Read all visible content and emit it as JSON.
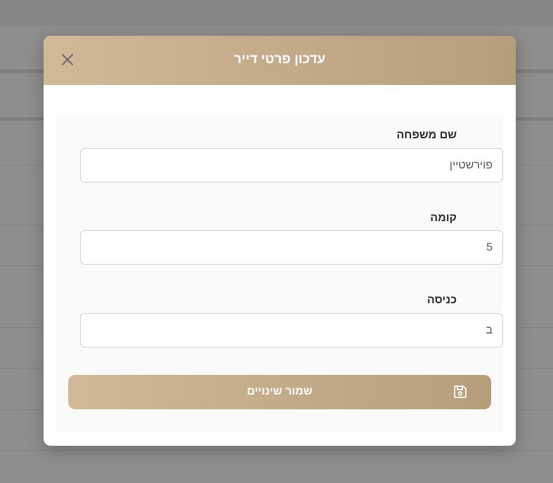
{
  "modal": {
    "title": "עדכון פרטי דייר",
    "close_icon": "close-icon"
  },
  "form": {
    "fields": [
      {
        "label": "שם משפחה",
        "value": "פוירשטיין"
      },
      {
        "label": "קומה",
        "value": "5"
      },
      {
        "label": "כניסה",
        "value": "ב"
      }
    ],
    "save_label": "שמור שינויים",
    "save_icon": "floppy-disk-icon"
  },
  "colors": {
    "accent_start": "#d1b997",
    "accent_end": "#b69e7c",
    "overlay": "#8e8e8e"
  }
}
